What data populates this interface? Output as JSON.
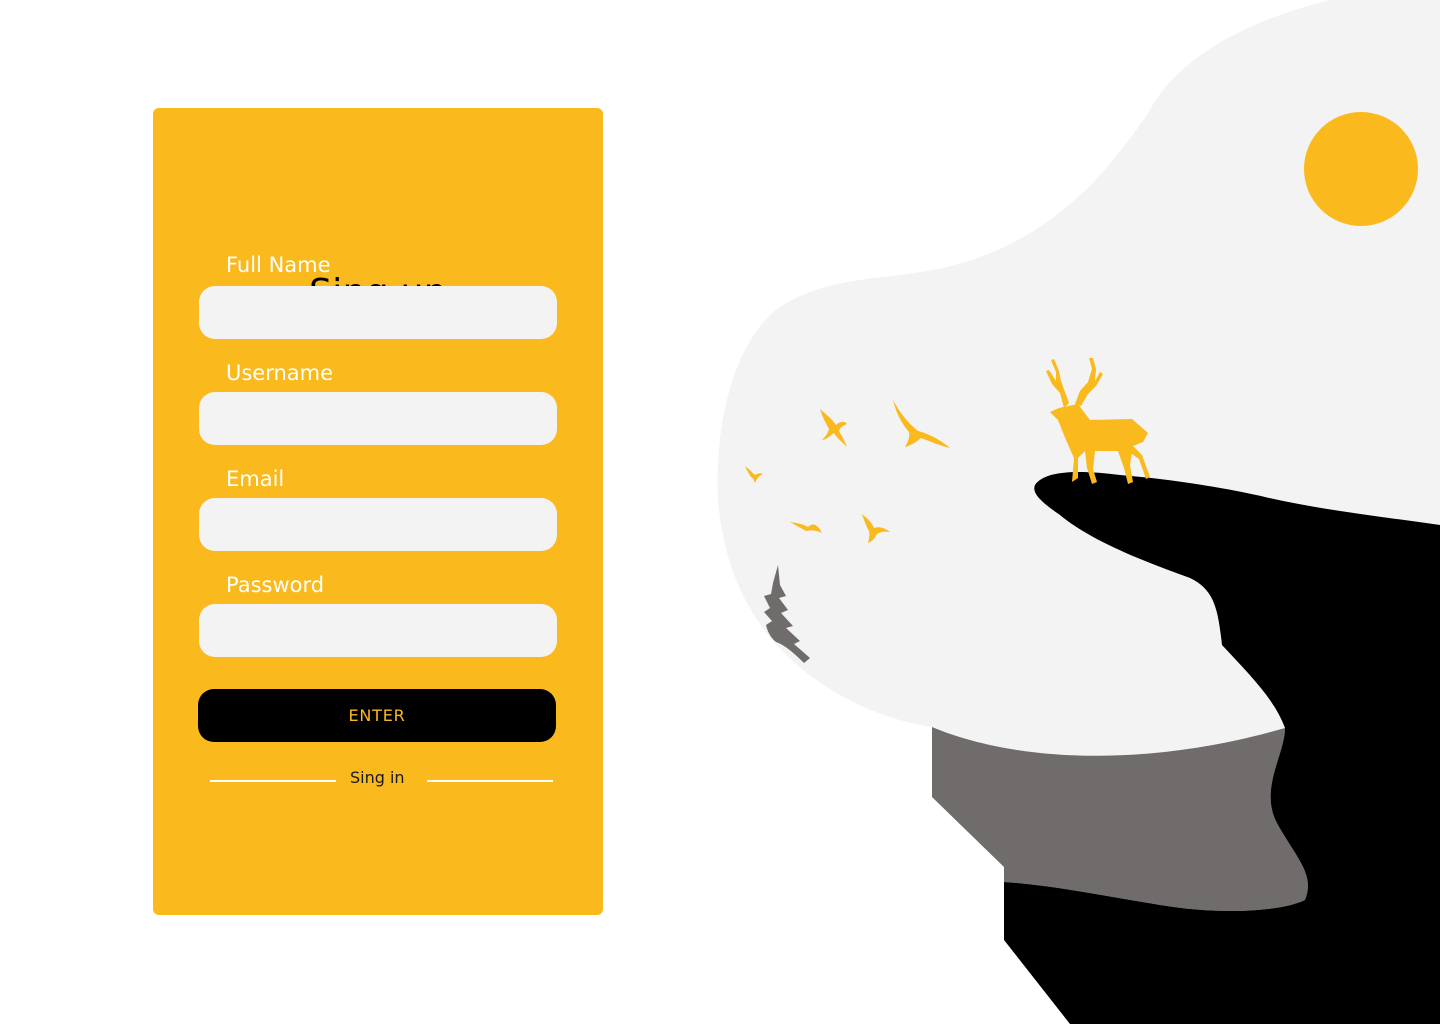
{
  "signup": {
    "title": "Sing up",
    "fields": [
      {
        "label": "Full Name",
        "value": "",
        "placeholder": ""
      },
      {
        "label": "Username",
        "value": "",
        "placeholder": ""
      },
      {
        "label": "Email",
        "value": "",
        "placeholder": ""
      },
      {
        "label": "Password",
        "value": "",
        "placeholder": ""
      }
    ],
    "enter_label": "ENTER",
    "signin_label": "Sing in"
  },
  "illustration": {
    "icons": [
      "sun-icon",
      "deer-icon",
      "bird-icon",
      "pine-tree-icon"
    ]
  },
  "colors": {
    "accent": "#fab91d",
    "card_background": "#fab91d",
    "input_background": "#f3f3f3",
    "button_background": "#000000",
    "scenery_fog": "#f3f3f3",
    "scenery_cliff": "#000000",
    "scenery_shadow": "#716c6c"
  }
}
